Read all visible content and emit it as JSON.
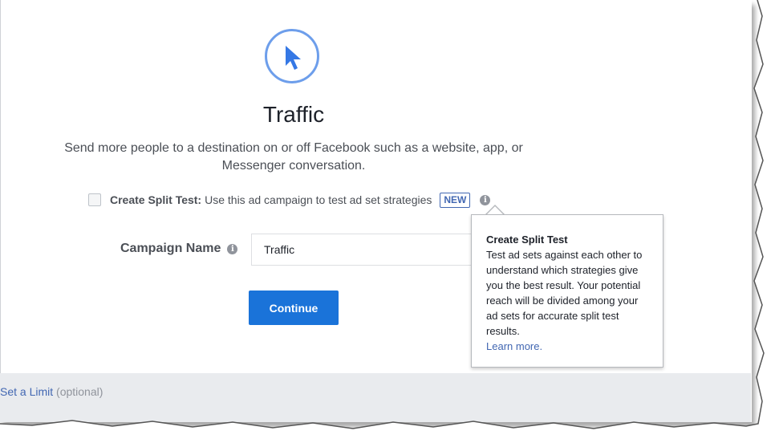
{
  "objective": {
    "icon": "cursor-icon",
    "title": "Traffic",
    "description": "Send more people to a destination on or off Facebook such as a website, app, or Messenger conversation."
  },
  "split_test": {
    "label": "Create Split Test:",
    "text": "Use this ad campaign to test ad set strategies",
    "badge": "NEW",
    "checked": false
  },
  "campaign_name": {
    "label": "Campaign Name",
    "value": "Traffic"
  },
  "continue_label": "Continue",
  "footer": {
    "link": "Set a Limit",
    "optional": "(optional)"
  },
  "tooltip": {
    "title": "Create Split Test",
    "body": "Test ad sets against each other to understand which strategies give you the best result. Your potential reach will be divided among your ad sets for accurate split test results.",
    "link": "Learn more."
  },
  "colors": {
    "accent_blue": "#1a73d9",
    "link_blue": "#4267b2",
    "icon_blue": "#6d9eeb",
    "footer_gray": "#e9ebee"
  }
}
